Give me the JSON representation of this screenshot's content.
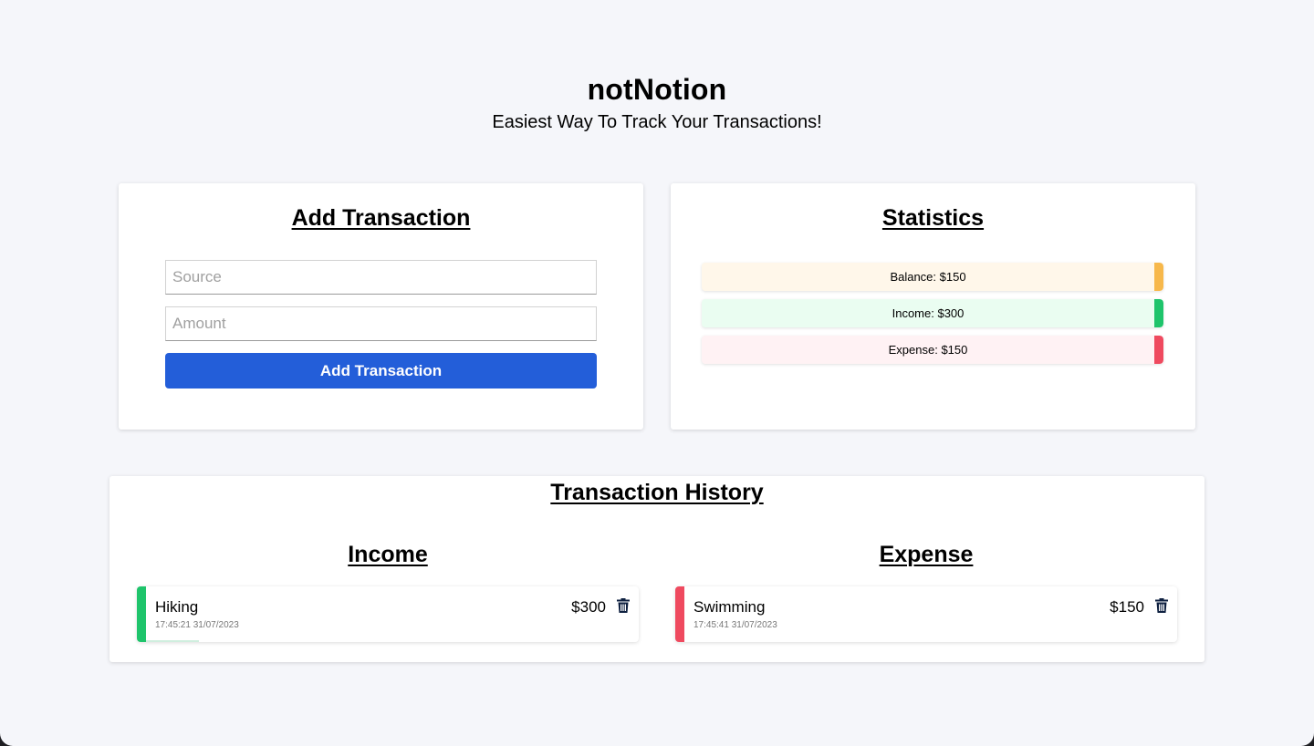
{
  "header": {
    "title": "notNotion",
    "subtitle": "Easiest Way To Track Your Transactions!"
  },
  "add_transaction": {
    "title": "Add Transaction",
    "source_placeholder": "Source",
    "amount_placeholder": "Amount",
    "button_label": "Add Transaction",
    "button_color": "#235ed9"
  },
  "statistics": {
    "title": "Statistics",
    "balance": {
      "label": "Balance: $150",
      "color": "#f7b84b"
    },
    "income": {
      "label": "Income: $300",
      "color": "#1ec46b"
    },
    "expense": {
      "label": "Expense: $150",
      "color": "#ef4a5f"
    }
  },
  "history": {
    "title": "Transaction History",
    "income": {
      "title": "Income",
      "items": [
        {
          "source": "Hiking",
          "time": "17:45:21 31/07/2023",
          "amount": "$300",
          "icon": "trash-icon"
        }
      ]
    },
    "expense": {
      "title": "Expense",
      "items": [
        {
          "source": "Swimming",
          "time": "17:45:41 31/07/2023",
          "amount": "$150",
          "icon": "trash-icon"
        }
      ]
    }
  }
}
